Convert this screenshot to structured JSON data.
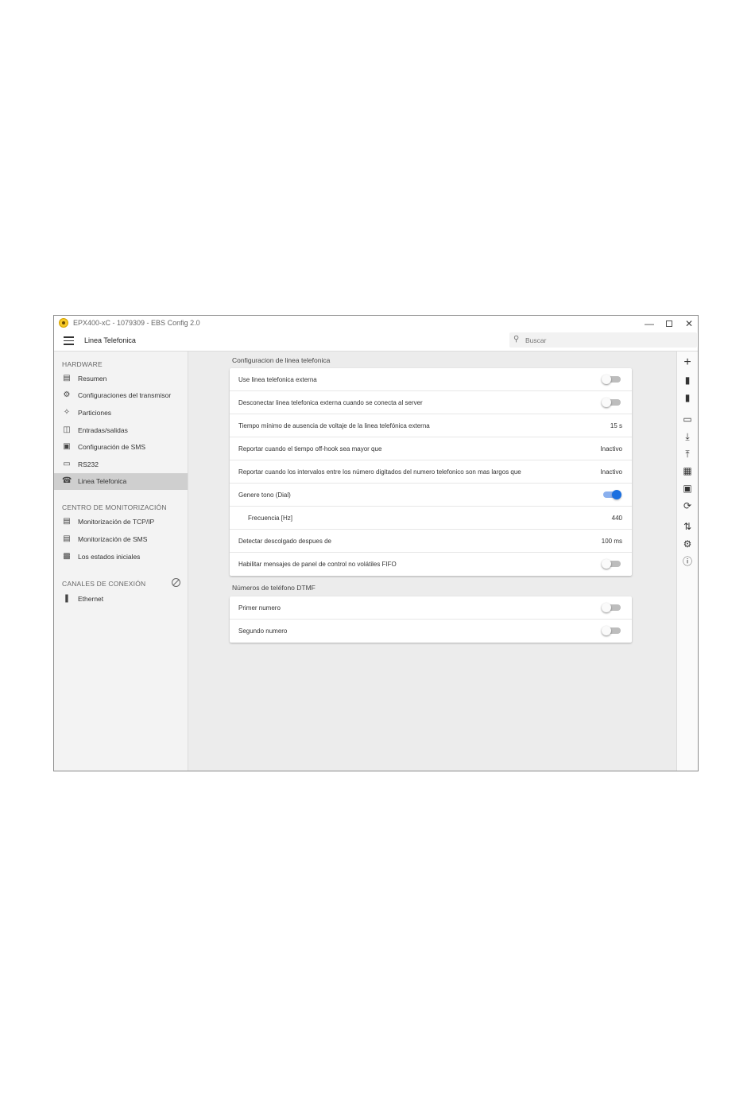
{
  "window": {
    "title": "EPX400-xC - 1079309 - EBS Config 2.0",
    "controls": {
      "minimize": "—",
      "close": "✕"
    }
  },
  "appbar": {
    "page_title": "Linea Telefonica",
    "search_placeholder": "Buscar"
  },
  "sidebar": {
    "sections": [
      {
        "header": "HARDWARE",
        "items": [
          {
            "label": "Resumen",
            "icon": "clipboard-icon"
          },
          {
            "label": "Configuraciones del transmisor",
            "icon": "gear-icon"
          },
          {
            "label": "Particiones",
            "icon": "partitions-icon"
          },
          {
            "label": "Entradas/salidas",
            "icon": "io-icon"
          },
          {
            "label": "Configuración de SMS",
            "icon": "sms-icon"
          },
          {
            "label": "RS232",
            "icon": "rs232-icon"
          },
          {
            "label": "Linea Telefonica",
            "icon": "phone-icon",
            "active": true
          }
        ]
      },
      {
        "header": "CENTRO DE MONITORIZACIÓN",
        "items": [
          {
            "label": "Monitorización de TCP/IP",
            "icon": "calendar-icon"
          },
          {
            "label": "Monitorización de SMS",
            "icon": "calendar-icon"
          },
          {
            "label": "Los estados iniciales",
            "icon": "states-icon"
          }
        ]
      },
      {
        "header": "CANALES DE CONEXIÓN",
        "items": [
          {
            "label": "Ethernet",
            "icon": "ethernet-plug-icon"
          }
        ]
      }
    ]
  },
  "main": {
    "section1": {
      "title": "Configuracion de linea telefonica",
      "rows": [
        {
          "label": "Use linea telefonica externa",
          "type": "toggle",
          "on": false
        },
        {
          "label": "Desconectar linea telefonica externa cuando se conecta al server",
          "type": "toggle",
          "on": false
        },
        {
          "label": "Tiempo mínimo de ausencia de voltaje de la linea telefónica externa",
          "type": "value",
          "value": "15 s"
        },
        {
          "label": "Reportar cuando el tiempo off-hook sea mayor que",
          "type": "value",
          "value": "Inactivo"
        },
        {
          "label": "Reportar cuando los intervalos entre los número digitados del numero telefonico son mas largos que",
          "type": "value",
          "value": "Inactivo"
        },
        {
          "label": "Genere tono (Dial)",
          "type": "toggle",
          "on": true
        },
        {
          "label": "Frecuencia [Hz]",
          "type": "value",
          "value": "440",
          "indent": true
        },
        {
          "label": "Detectar descolgado despues de",
          "type": "value",
          "value": "100 ms"
        },
        {
          "label": "Habilitar mensajes de panel de control no volátiles FIFO",
          "type": "toggle",
          "on": false
        }
      ]
    },
    "section2": {
      "title": "Números de teléfono DTMF",
      "rows": [
        {
          "label": "Primer numero",
          "type": "toggle",
          "on": false
        },
        {
          "label": "Segundo numero",
          "type": "toggle",
          "on": false
        }
      ]
    }
  },
  "rightbar": {
    "icons": [
      "plus-icon",
      "folder-download-icon",
      "folder-upload-icon",
      "monitor-icon",
      "download-icon",
      "upload-icon",
      "calendar-icon",
      "firmware-icon",
      "refresh-icon",
      "transfer-icon",
      "settings-icon",
      "help-icon"
    ]
  },
  "colors": {
    "accent": "#1a6fe0",
    "active_item": "#cfcfcf",
    "sidebar_bg": "#f3f3f3",
    "main_bg": "#ececec"
  }
}
